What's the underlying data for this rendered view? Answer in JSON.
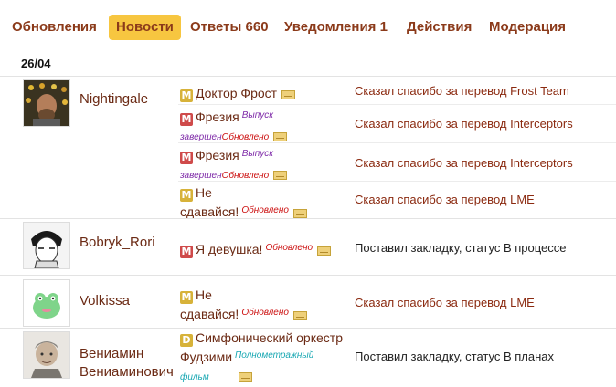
{
  "tabs": [
    {
      "label": "Обновления",
      "active": false
    },
    {
      "label": "Новости",
      "active": true
    },
    {
      "label": "Ответы 660",
      "active": false
    },
    {
      "label": "Уведомления 1",
      "active": false
    },
    {
      "label": "Действия",
      "active": false
    },
    {
      "label": "Модерация",
      "active": false
    }
  ],
  "date": "26/04",
  "users": [
    {
      "name": "Nightingale",
      "entries": [
        {
          "icon": "manga-icon",
          "title": "Доктор Фрост",
          "tag1": "",
          "tag2": "",
          "action": "Сказал спасибо за перевод Frost Team"
        },
        {
          "icon": "manhwa-icon",
          "title": "Фрезия",
          "tag1": "Выпуск",
          "tag2": "завершен",
          "tag3": "Обновлено",
          "action": "Сказал спасибо за перевод Interceptors"
        },
        {
          "icon": "manhwa-icon",
          "title": "Фрезия",
          "tag1": "Выпуск",
          "tag2": "завершен",
          "tag3": "Обновлено",
          "action": "Сказал спасибо за перевод Interceptors"
        },
        {
          "icon": "manga-icon",
          "title_line1": "Не",
          "title_line2": "сдавайся!",
          "tag3": "Обновлено",
          "action": "Сказал спасибо за перевод LME"
        }
      ]
    },
    {
      "name": "Bobryk_Rori",
      "entries": [
        {
          "icon": "manhwa-icon",
          "title": "Я девушка!",
          "tag3": "Обновлено",
          "action": "Поставил закладку, статус В процессе"
        }
      ]
    },
    {
      "name": "Volkissa",
      "entries": [
        {
          "icon": "manga-icon",
          "title_line1": "Не",
          "title_line2": "сдавайся!",
          "tag3": "Обновлено",
          "action": "Сказал спасибо за перевод LME"
        }
      ]
    },
    {
      "name_line1": "Вениамин",
      "name_line2": "Вениаминович",
      "entries": [
        {
          "icon": "dorama-icon",
          "title_line1": "Симфонический оркестр",
          "title_line2": "Фудзими",
          "tag1": "Полнометражный",
          "tag2": "фильм",
          "action": "Поставил закладку, статус В планах"
        }
      ]
    }
  ],
  "icon_letters": {
    "manga": "M",
    "manhwa": "M",
    "dorama": "D"
  },
  "colors": {
    "accent": "#f7c640",
    "link": "#8b3a1a",
    "updated": "#cc1010",
    "release": "#7e2aa8",
    "film": "#1aa8b3"
  }
}
